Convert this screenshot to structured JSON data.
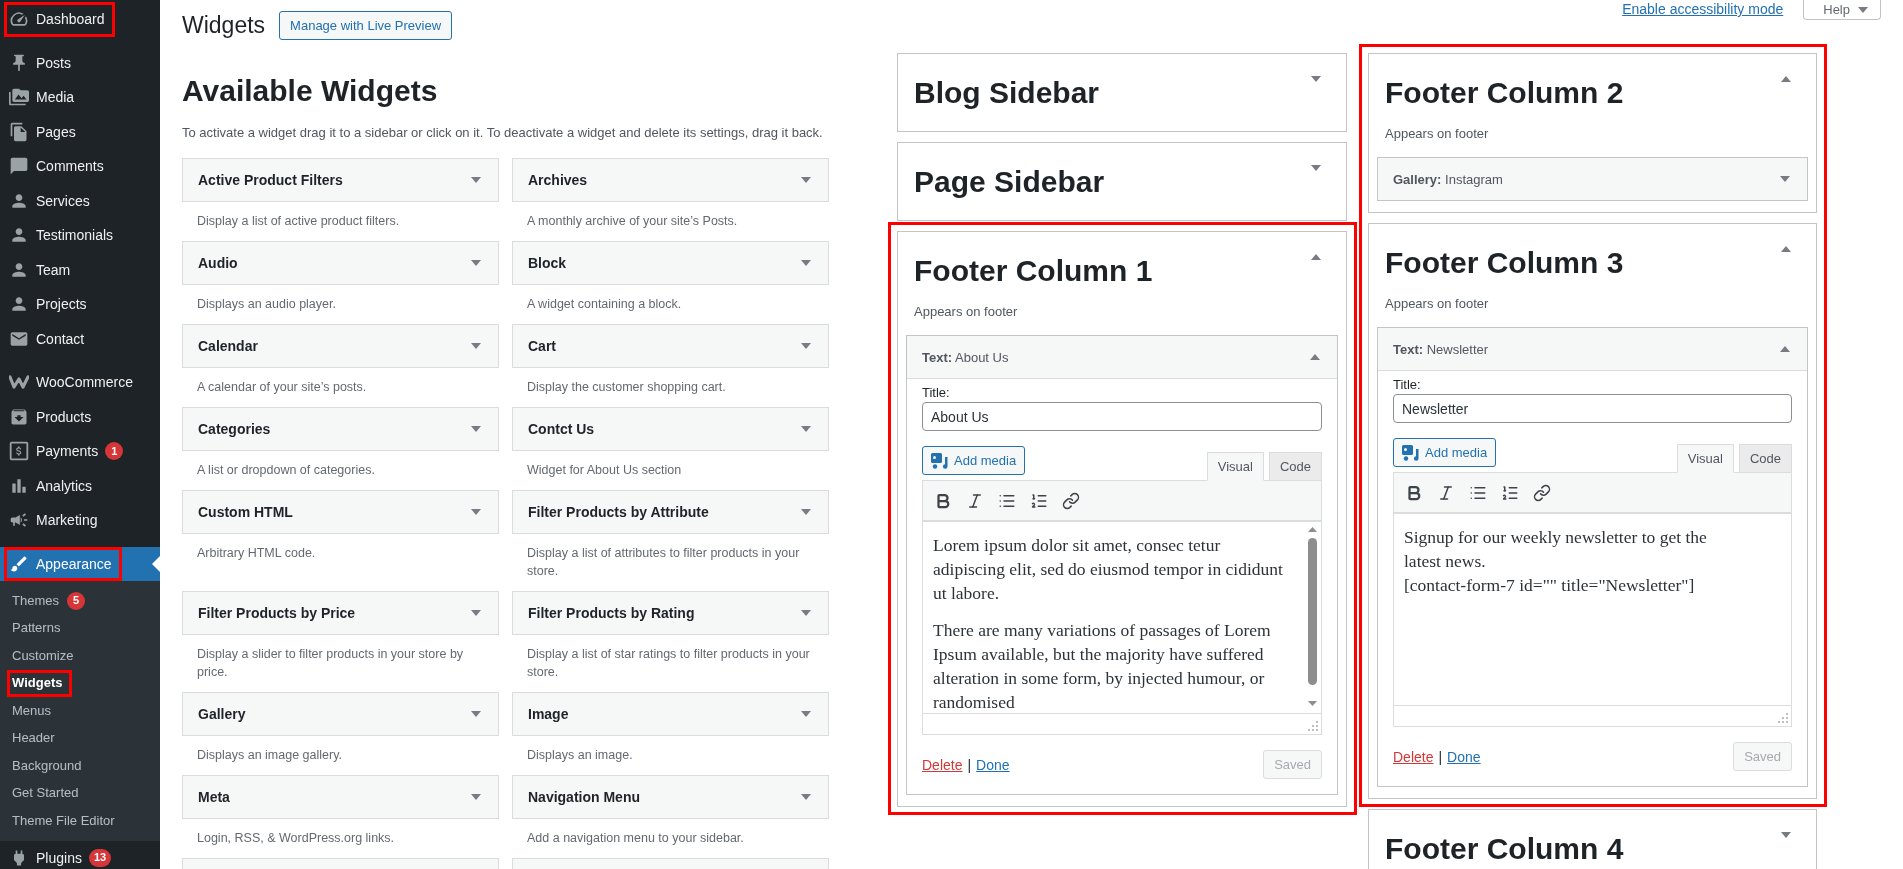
{
  "admin_menu": {
    "groups": [
      [
        {
          "label": "Dashboard",
          "selected": false,
          "highlighted": true
        }
      ],
      [
        {
          "label": "Posts",
          "selected": false,
          "highlighted": false
        },
        {
          "label": "Media",
          "selected": false,
          "highlighted": false
        },
        {
          "label": "Pages",
          "selected": false,
          "highlighted": false
        },
        {
          "label": "Comments",
          "selected": false,
          "highlighted": false
        },
        {
          "label": "Services",
          "selected": false,
          "highlighted": false
        },
        {
          "label": "Testimonials",
          "selected": false,
          "highlighted": false
        },
        {
          "label": "Team",
          "selected": false,
          "highlighted": false
        },
        {
          "label": "Projects",
          "selected": false,
          "highlighted": false
        },
        {
          "label": "Contact",
          "selected": false,
          "highlighted": false
        }
      ],
      [
        {
          "label": "WooCommerce",
          "selected": false,
          "highlighted": false
        },
        {
          "label": "Products",
          "selected": false,
          "highlighted": false
        },
        {
          "label": "Payments",
          "badge": "1",
          "selected": false,
          "highlighted": false
        },
        {
          "label": "Analytics",
          "selected": false,
          "highlighted": false
        },
        {
          "label": "Marketing",
          "selected": false,
          "highlighted": false
        }
      ],
      [
        {
          "label": "Appearance",
          "selected": true,
          "highlighted": true,
          "submenu": [
            {
              "label": "Themes",
              "badge": "5",
              "selected": false,
              "highlighted": false
            },
            {
              "label": "Patterns",
              "selected": false,
              "highlighted": false
            },
            {
              "label": "Customize",
              "selected": false,
              "highlighted": false
            },
            {
              "label": "Widgets",
              "selected": true,
              "highlighted": true
            },
            {
              "label": "Menus",
              "selected": false,
              "highlighted": false
            },
            {
              "label": "Header",
              "selected": false,
              "highlighted": false
            },
            {
              "label": "Background",
              "selected": false,
              "highlighted": false
            },
            {
              "label": "Get Started",
              "selected": false,
              "highlighted": false
            },
            {
              "label": "Theme File Editor",
              "selected": false,
              "highlighted": false
            }
          ]
        },
        {
          "label": "Plugins",
          "badge": "13",
          "selected": false,
          "highlighted": false
        }
      ]
    ]
  },
  "header": {
    "title": "Widgets",
    "live_preview_button": "Manage with Live Preview",
    "accessibility_link": "Enable accessibility mode",
    "help_tab": "Help"
  },
  "available_widgets": {
    "title": "Available Widgets",
    "instructions": "To activate a widget drag it to a sidebar or click on it. To deactivate a widget and delete its settings, drag it back.",
    "widgets": [
      {
        "title": "Active Product Filters",
        "description": "Display a list of active product filters."
      },
      {
        "title": "Archives",
        "description": "A monthly archive of your site’s Posts."
      },
      {
        "title": "Audio",
        "description": "Displays an audio player."
      },
      {
        "title": "Block",
        "description": "A widget containing a block."
      },
      {
        "title": "Calendar",
        "description": "A calendar of your site’s posts."
      },
      {
        "title": "Cart",
        "description": "Display the customer shopping cart."
      },
      {
        "title": "Categories",
        "description": "A list or dropdown of categories."
      },
      {
        "title": "Contct Us",
        "description": "Widget for About Us section"
      },
      {
        "title": "Custom HTML",
        "description": "Arbitrary HTML code."
      },
      {
        "title": "Filter Products by Attribute",
        "description": "Display a list of attributes to filter products in your store."
      },
      {
        "title": "Filter Products by Price",
        "description": "Display a slider to filter products in your store by price."
      },
      {
        "title": "Filter Products by Rating",
        "description": "Display a list of star ratings to filter products in your store."
      },
      {
        "title": "Gallery",
        "description": "Displays an image gallery."
      },
      {
        "title": "Image",
        "description": "Displays an image."
      },
      {
        "title": "Meta",
        "description": "Login, RSS, & WordPress.org links."
      },
      {
        "title": "Navigation Menu",
        "description": "Add a navigation menu to your sidebar."
      }
    ],
    "more_below": true
  },
  "widget_areas": {
    "columns": [
      [
        {
          "title": "Blog Sidebar",
          "expanded": false,
          "highlighted": false
        },
        {
          "title": "Page Sidebar",
          "expanded": false,
          "highlighted": false
        },
        {
          "title": "Footer Column 1",
          "expanded": true,
          "highlighted": true,
          "description": "Appears on footer",
          "widgets": [
            {
              "heading": "**Text:** About Us",
              "expanded": true,
              "title_label": "Title:",
              "title_value": "About Us",
              "add_media": "Add media",
              "tabs": [
                {
                  "label": "Visual",
                  "selected": true
                },
                {
                  "label": "Code",
                  "selected": false
                }
              ],
              "content": [
                "Lorem ipsum dolor sit amet, consec tetur adipiscing elit, sed do eiusmod tempor in cididunt ut labore.",
                "There are many variations of passages of Lorem Ipsum available, but the majority have suffered alteration in some form, by injected humour, or randomised"
              ],
              "scrollbar": true,
              "delete_link": "Delete",
              "separator": "|",
              "done_link": "Done",
              "save_button": {
                "label": "Saved",
                "disabled": true
              }
            }
          ]
        }
      ],
      [
        {
          "title": "Footer Column 2",
          "expanded": true,
          "highlighted": true,
          "description": "Appears on footer",
          "widgets": [
            {
              "heading": "**Gallery:** Instagram",
              "expanded": false
            }
          ]
        },
        {
          "title": "Footer Column 3",
          "expanded": true,
          "highlighted": true,
          "description": "Appears on footer",
          "widgets": [
            {
              "heading": "**Text:** Newsletter",
              "expanded": true,
              "title_label": "Title:",
              "title_value": "Newsletter",
              "add_media": "Add media",
              "tabs": [
                {
                  "label": "Visual",
                  "selected": true
                },
                {
                  "label": "Code",
                  "selected": false
                }
              ],
              "content": [
                "Signup for our weekly newsletter to get the\nlatest news.\n[contact-form-7 id=\"\" title=\"Newsletter\"]"
              ],
              "scrollbar": false,
              "delete_link": "Delete",
              "separator": "|",
              "done_link": "Done",
              "save_button": {
                "label": "Saved",
                "disabled": true
              }
            }
          ]
        },
        {
          "title": "Footer Column 4",
          "expanded": false,
          "highlighted": false
        }
      ]
    ]
  }
}
